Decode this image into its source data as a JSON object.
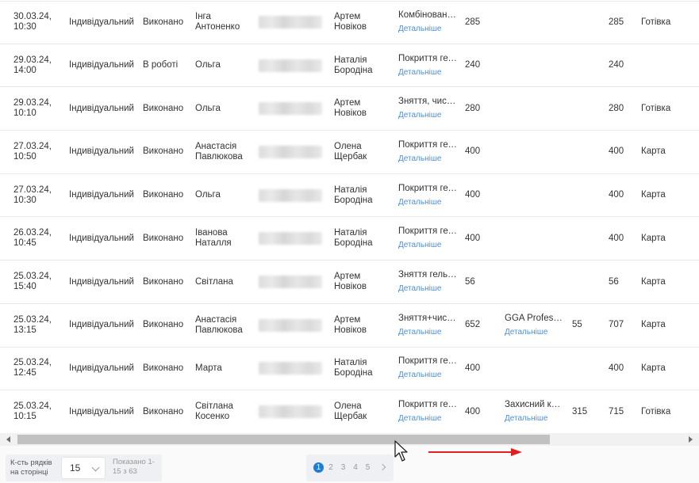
{
  "table": {
    "rows": [
      {
        "date": "30.03.24,",
        "time": "10:30",
        "type": "Індивідуальний",
        "status": "Виконано",
        "client": [
          "Інга",
          "Антоненко"
        ],
        "master": [
          "Артем",
          "Новіков"
        ],
        "service": "Комбінований...",
        "service_link": "Детальніше",
        "price1": "285",
        "product": "",
        "product_link": "",
        "price2": "",
        "total": "285",
        "payment": "Готівка"
      },
      {
        "date": "29.03.24,",
        "time": "14:00",
        "type": "Індивідуальний",
        "status": "В роботі",
        "client": [
          "Ольга",
          ""
        ],
        "master": [
          "Наталія",
          "Бородіна"
        ],
        "service": "Покриття гель-лаком",
        "service_link": "Детальніше",
        "price1": "240",
        "product": "",
        "product_link": "",
        "price2": "",
        "total": "240",
        "payment": ""
      },
      {
        "date": "29.03.24,",
        "time": "10:10",
        "type": "Індивідуальний",
        "status": "Виконано",
        "client": [
          "Ольга",
          ""
        ],
        "master": [
          "Артем",
          "Новіков"
        ],
        "service": "Зняття, чистка",
        "service_link": "Детальніше",
        "price1": "280",
        "product": "",
        "product_link": "",
        "price2": "",
        "total": "280",
        "payment": "Готівка"
      },
      {
        "date": "27.03.24,",
        "time": "10:50",
        "type": "Індивідуальний",
        "status": "Виконано",
        "client": [
          "Анастасія",
          "Павлюкова"
        ],
        "master": [
          "Олена",
          "Щербак"
        ],
        "service": "Покриття гель-лаком",
        "service_link": "Детальніше",
        "price1": "400",
        "product": "",
        "product_link": "",
        "price2": "",
        "total": "400",
        "payment": "Карта"
      },
      {
        "date": "27.03.24,",
        "time": "10:30",
        "type": "Індивідуальний",
        "status": "Виконано",
        "client": [
          "Ольга",
          ""
        ],
        "master": [
          "Наталія",
          "Бородіна"
        ],
        "service": "Покриття гель-лаком",
        "service_link": "Детальніше",
        "price1": "400",
        "product": "",
        "product_link": "",
        "price2": "",
        "total": "400",
        "payment": "Карта"
      },
      {
        "date": "26.03.24,",
        "time": "10:45",
        "type": "Індивідуальний",
        "status": "Виконано",
        "client": [
          "Іванова",
          "Наталля"
        ],
        "master": [
          "Наталія",
          "Бородіна"
        ],
        "service": "Покриття гель-лаком",
        "service_link": "Детальніше",
        "price1": "400",
        "product": "",
        "product_link": "",
        "price2": "",
        "total": "400",
        "payment": "Карта"
      },
      {
        "date": "25.03.24,",
        "time": "15:40",
        "type": "Індивідуальний",
        "status": "Виконано",
        "client": [
          "Світлана",
          ""
        ],
        "master": [
          "Артем",
          "Новіков"
        ],
        "service": "Зняття гель-лаку",
        "service_link": "Детальніше",
        "price1": "56",
        "product": "",
        "product_link": "",
        "price2": "",
        "total": "56",
        "payment": "Карта"
      },
      {
        "date": "25.03.24,",
        "time": "13:15",
        "type": "Індивідуальний",
        "status": "Виконано",
        "client": [
          "Анастасія",
          "Павлюкова"
        ],
        "master": [
          "Артем",
          "Новіков"
        ],
        "service": "Зняття+чистка",
        "service_link": "Детальніше",
        "price1": "652",
        "product": "GGA Professional",
        "product_link": "Детальніше",
        "price2": "55",
        "total": "707",
        "payment": "Карта"
      },
      {
        "date": "25.03.24,",
        "time": "12:45",
        "type": "Індивідуальний",
        "status": "Виконано",
        "client": [
          "Марта",
          ""
        ],
        "master": [
          "Наталія",
          "Бородіна"
        ],
        "service": "Покриття гель-лаком",
        "service_link": "Детальніше",
        "price1": "400",
        "product": "",
        "product_link": "",
        "price2": "",
        "total": "400",
        "payment": "Карта"
      },
      {
        "date": "25.03.24,",
        "time": "10:15",
        "type": "Індивідуальний",
        "status": "Виконано",
        "client": [
          "Світлана",
          "Косенко"
        ],
        "master": [
          "Олена",
          "Щербак"
        ],
        "service": "Покриття гель-лаком",
        "service_link": "Детальніше",
        "price1": "400",
        "product": "Захисний крем",
        "product_link": "Детальніше",
        "price2": "315",
        "total": "715",
        "payment": "Готівка"
      }
    ]
  },
  "footer": {
    "rows_label": "К-сть рядків на сторінці",
    "rows_value": "15",
    "shown_text": "Показано 1-15 з 63",
    "pages": [
      "1",
      "2",
      "3",
      "4",
      "5"
    ],
    "active_page": "1"
  },
  "colors": {
    "link": "#4a90d9",
    "active_page": "#1e7bd6",
    "annotation_arrow": "#e02020"
  },
  "icons": {
    "scroll_left": "triangle-left-icon",
    "scroll_right": "triangle-right-icon",
    "select": "chevron-down-icon",
    "pager_next": "chevron-right-icon",
    "cursor": "mouse-pointer-icon",
    "annotation": "red-arrow-right-icon"
  }
}
